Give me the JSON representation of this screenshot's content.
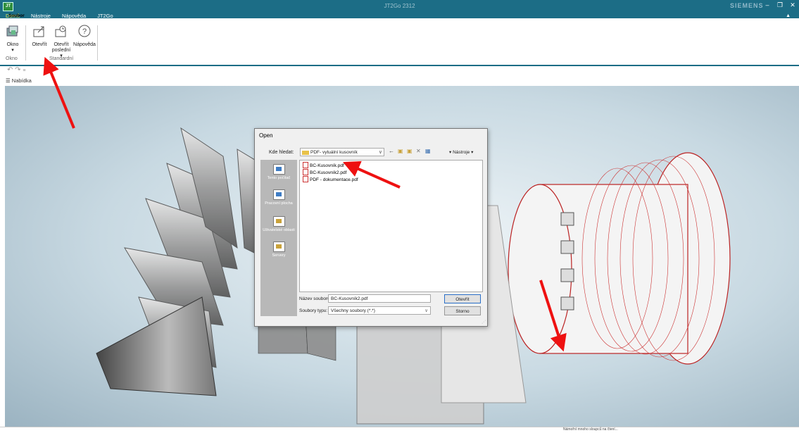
{
  "window": {
    "title": "JT2Go 2312",
    "brand": "SIEMENS",
    "min": "–",
    "restore": "❐",
    "close": "✕"
  },
  "menu": {
    "tabs": [
      "Soubor",
      "Domů",
      "Nástroje",
      "Nápověda",
      "JT2Go"
    ],
    "collapse": "▲"
  },
  "ribbon": {
    "buttons": [
      {
        "label": "Okno",
        "sub": "▾",
        "icon": "window-icon"
      },
      {
        "label": "Otevřít",
        "sub": "",
        "icon": "open-icon"
      },
      {
        "label": "Otevřít",
        "sub": "poslední ▾",
        "icon": "open-recent-icon"
      },
      {
        "label": "Nápověda",
        "sub": "",
        "icon": "help-icon"
      }
    ],
    "groups": [
      "Okno",
      "Standardní"
    ],
    "help_glyph": "?"
  },
  "qat": {
    "undo": "↶",
    "redo": "↷",
    "more": "≡"
  },
  "nabidka": {
    "label": "☰ Nabídka"
  },
  "dialog": {
    "title": "Open",
    "look_in_label": "Kde hledat:",
    "look_in_value": "PDF- vytuální kusovník",
    "combo_chev": "∨",
    "tools_label": "▾ Nástroje ▾",
    "tool_icons": [
      "←",
      "▣",
      "▣",
      "✕",
      "▦"
    ],
    "places": [
      "Tento počítač",
      "Pracovní plocha",
      "Uživatelské oblasti",
      "Servery"
    ],
    "files": [
      "BC-Kusovník.pdf",
      "BC-Kusovník2.pdf",
      "PDF - dokumentace.pdf"
    ],
    "filename_label": "Název souboru:",
    "filename_value": "BC-Kusovník2.pdf",
    "filetype_label": "Soubory typu:",
    "filetype_value": "Všechny soubory (*.*)",
    "filetype_chev": "∨",
    "open_button": "Otevřít",
    "cancel_button": "Storno",
    "grip": "⋰"
  },
  "status": {
    "message": "Námořní mnoho sloupců na čtení..."
  },
  "colors": {
    "accent": "#1c6d86",
    "active_tab": "#e8f05a",
    "arrow": "#ee1111"
  }
}
